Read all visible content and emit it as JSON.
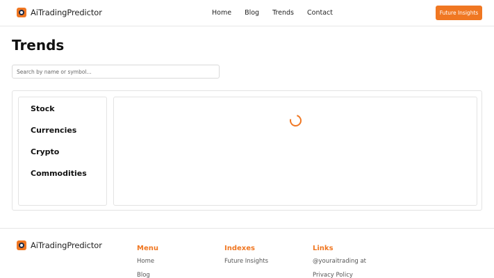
{
  "brand": {
    "name": "AiTradingPredictor"
  },
  "nav": {
    "items": [
      "Home",
      "Blog",
      "Trends",
      "Contact"
    ]
  },
  "header": {
    "cta_label": "Future Insights"
  },
  "page": {
    "title": "Trends"
  },
  "search": {
    "placeholder": "Search by name or symbol..."
  },
  "categories": [
    "Stock",
    "Currencies",
    "Crypto",
    "Commodities"
  ],
  "footer": {
    "brand_name": "AiTradingPredictor",
    "columns": [
      {
        "heading": "Menu",
        "links": [
          "Home",
          "Blog"
        ]
      },
      {
        "heading": "Indexes",
        "links": [
          "Future Insights"
        ]
      },
      {
        "heading": "Links",
        "links": [
          "@youraitrading at",
          "Privacy Policy"
        ]
      }
    ]
  },
  "colors": {
    "accent": "#f07722",
    "text": "#111111",
    "border": "#e3e3e3"
  },
  "icons": {
    "logo": "brand-logo-icon",
    "loading": "loading-spinner-icon"
  }
}
